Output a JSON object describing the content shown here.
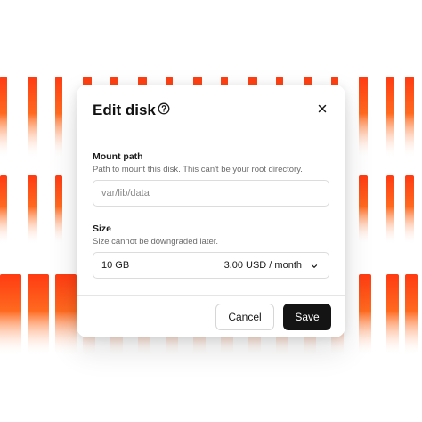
{
  "modal": {
    "title": "Edit disk",
    "mount_path": {
      "label": "Mount path",
      "help": "Path to mount this disk. This can't be your root directory.",
      "placeholder": "var/lib/data",
      "value": ""
    },
    "size": {
      "label": "Size",
      "help": "Size cannot be downgraded later.",
      "selected": "10 GB",
      "price": "3.00 USD / month"
    },
    "cancel_label": "Cancel",
    "save_label": "Save"
  },
  "icons": {
    "help": "help-circle-icon",
    "close": "close-icon",
    "dropdown": "chevron-down-icon"
  },
  "colors": {
    "stripe_top": "#ff3b12",
    "stripe_mid": "#ff6a1f",
    "primary_button": "#141414"
  }
}
